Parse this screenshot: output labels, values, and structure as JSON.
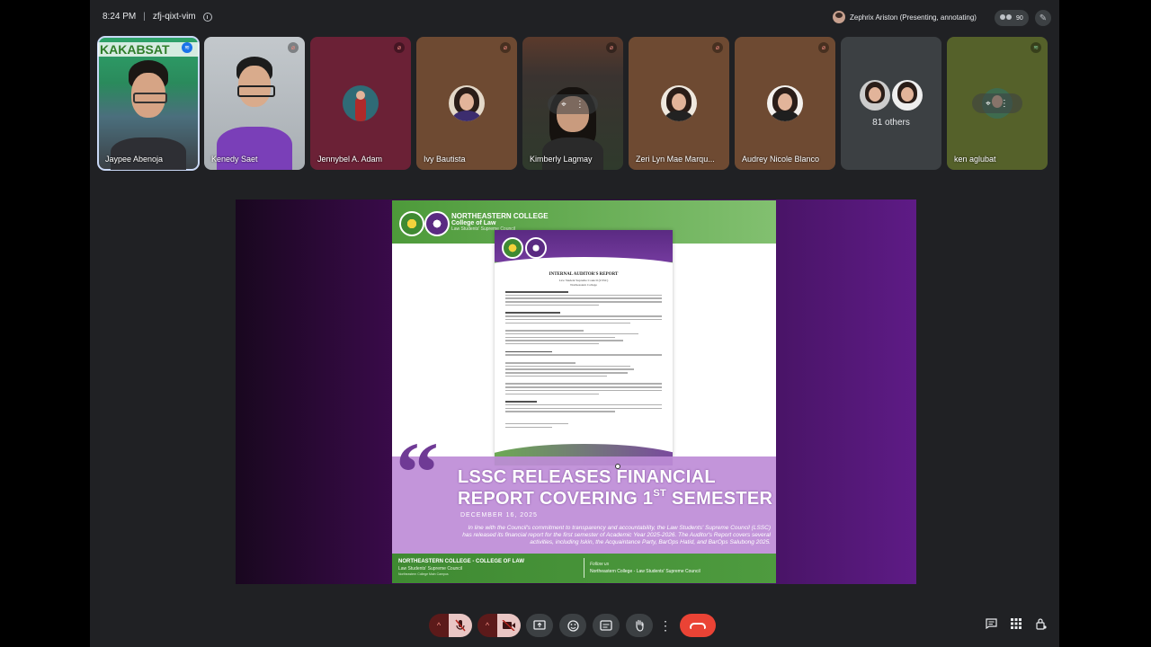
{
  "meeting": {
    "time": "8:24 PM",
    "code": "zfj-qixt-vim"
  },
  "presenter": {
    "label": "Zephrix Ariston (Presenting, annotating)"
  },
  "participant_count": "90",
  "participants": [
    {
      "name": "Jaypee Abenoja",
      "mic": "talking",
      "active": true
    },
    {
      "name": "Kenedy Saet",
      "mic": "muted"
    },
    {
      "name": "Jennybel A. Adam",
      "mic": "muted"
    },
    {
      "name": "Ivy Bautista",
      "mic": "muted"
    },
    {
      "name": "Kimberly Lagmay",
      "mic": "muted"
    },
    {
      "name": "Zeri Lyn Mae Marqu...",
      "mic": "muted"
    },
    {
      "name": "Audrey Nicole Blanco",
      "mic": "muted"
    },
    {
      "name": "81 others"
    },
    {
      "name": "ken aglubat",
      "mic": "talking"
    }
  ],
  "tile_banner": "KAKABSAT",
  "slide": {
    "header_line1": "NORTHEASTERN COLLEGE",
    "header_line2": "College of Law",
    "header_line3": "Law Students' Supreme Council",
    "doc_title": "INTERNAL AUDITOR'S REPORT",
    "doc_sub1": "Law Student Supreme Council (LSSC)",
    "doc_sub2": "Northeastern College",
    "headline_line1": "LSSC RELEASES FINANCIAL",
    "headline_line2": "REPORT COVERING 1",
    "headline_sup": "ST",
    "headline_line2_end": " SEMESTER",
    "date": "DECEMBER 16, 2025",
    "blurb": "In line with the Council's commitment to transparency and accountability, the Law Students' Supreme Council (LSSC) has released its financial report for the first semester of Academic Year 2025-2026. The Auditor's Report covers several activities, including Iskin, the Acquaintance Party, BarOps Hatid, and BarOps Salubong 2025.",
    "footer_left1": "NORTHEASTERN COLLEGE - COLLEGE OF LAW",
    "footer_left2": "Law Students' Supreme Council",
    "footer_left3": "Northeastern College Main Campus",
    "footer_right1": "Follow us",
    "footer_right2": "Northeastern College - Law Students' Supreme Council"
  },
  "colors": {
    "green": "#4d9a3a",
    "purple": "#7b3fa6",
    "hangup_red": "#ea4335",
    "mute_red": "#5c1a1a"
  },
  "controls": [
    "mic-off-icon",
    "camera-off-icon",
    "present-icon",
    "emoji-icon",
    "captions-icon",
    "raise-hand-icon",
    "more-options-icon",
    "hang-up-icon"
  ],
  "right_controls": [
    "chat-icon",
    "activities-icon",
    "host-controls-icon"
  ]
}
